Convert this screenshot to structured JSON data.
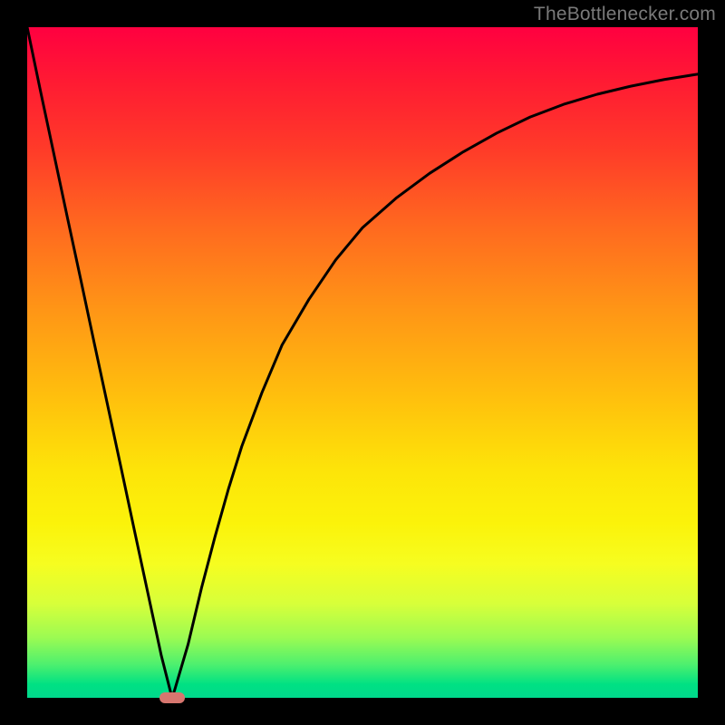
{
  "watermark": {
    "text": "TheBottlenecker.com"
  },
  "chart_data": {
    "type": "line",
    "title": "",
    "xlabel": "",
    "ylabel": "",
    "xlim": [
      0,
      100
    ],
    "ylim": [
      0,
      100
    ],
    "x": [
      0,
      2,
      4,
      6,
      8,
      10,
      12,
      14,
      16,
      18,
      20,
      21.6,
      22,
      24,
      26,
      28,
      30,
      32,
      35,
      38,
      42,
      46,
      50,
      55,
      60,
      65,
      70,
      75,
      80,
      85,
      90,
      95,
      100
    ],
    "values": [
      100,
      90.4,
      81.0,
      71.6,
      62.3,
      52.9,
      43.6,
      34.3,
      24.9,
      15.6,
      6.3,
      0,
      1.2,
      8.0,
      16.4,
      24.0,
      31.1,
      37.5,
      45.5,
      52.6,
      59.4,
      65.3,
      70.1,
      74.5,
      78.2,
      81.4,
      84.2,
      86.6,
      88.5,
      90.0,
      91.2,
      92.2,
      93.0
    ],
    "marker": {
      "x": 21.6,
      "y": 0
    },
    "gradient_stops": [
      {
        "pos": 0,
        "color": "#ff0040"
      },
      {
        "pos": 50,
        "color": "#ffbf0d"
      },
      {
        "pos": 80,
        "color": "#f6fd20"
      },
      {
        "pos": 100,
        "color": "#00d88c"
      }
    ]
  }
}
